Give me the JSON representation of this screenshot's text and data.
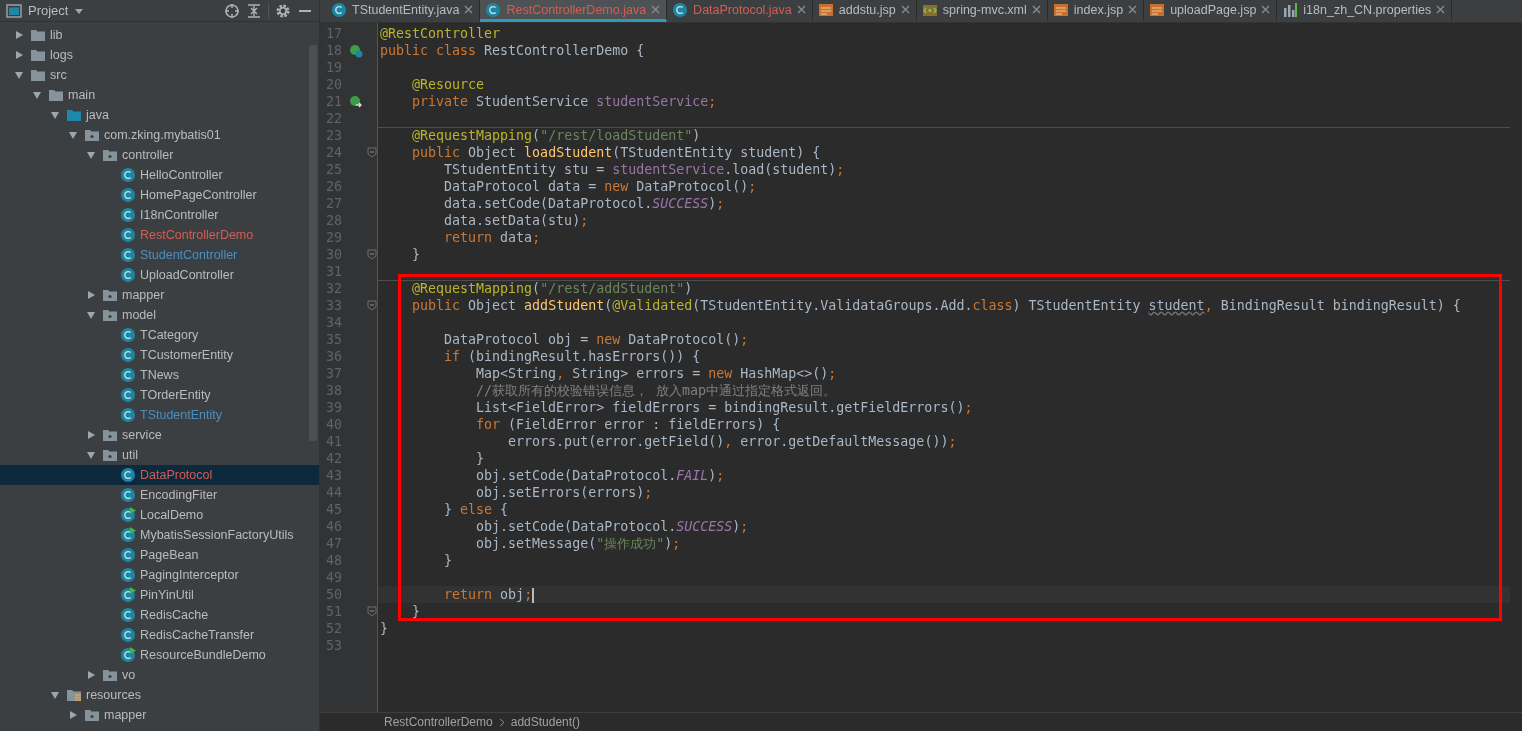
{
  "sidebar": {
    "title": "Project",
    "tree": [
      {
        "label": "lib",
        "kind": "folder",
        "expanded": false,
        "selected": false,
        "color": "#bbbbbb"
      },
      {
        "label": "logs",
        "kind": "folder",
        "expanded": false,
        "selected": false,
        "color": "#bbbbbb"
      },
      {
        "label": "src",
        "kind": "folder",
        "expanded": true,
        "selected": false,
        "color": "#bbbbbb",
        "children": [
          {
            "label": "main",
            "kind": "folder",
            "expanded": true,
            "selected": false,
            "color": "#bbbbbb",
            "children": [
              {
                "label": "java",
                "kind": "source-folder",
                "expanded": true,
                "selected": false,
                "color": "#bbbbbb",
                "children": [
                  {
                    "label": "com.zking.mybatis01",
                    "kind": "package",
                    "expanded": true,
                    "selected": false,
                    "color": "#bbbbbb",
                    "children": [
                      {
                        "label": "controller",
                        "kind": "package",
                        "expanded": true,
                        "selected": false,
                        "color": "#bbbbbb",
                        "children": [
                          {
                            "label": "HelloController",
                            "kind": "class",
                            "runnable": false,
                            "selected": false,
                            "color": "#bbbbbb"
                          },
                          {
                            "label": "HomePageController",
                            "kind": "class",
                            "runnable": false,
                            "selected": false,
                            "color": "#bbbbbb"
                          },
                          {
                            "label": "I18nController",
                            "kind": "class",
                            "runnable": false,
                            "selected": false,
                            "color": "#bbbbbb"
                          },
                          {
                            "label": "RestControllerDemo",
                            "kind": "class",
                            "runnable": false,
                            "selected": false,
                            "color": "#d65c52"
                          },
                          {
                            "label": "StudentController",
                            "kind": "class",
                            "runnable": false,
                            "selected": false,
                            "color": "#4a8fc2"
                          },
                          {
                            "label": "UploadController",
                            "kind": "class",
                            "runnable": false,
                            "selected": false,
                            "color": "#bbbbbb"
                          }
                        ]
                      },
                      {
                        "label": "mapper",
                        "kind": "package",
                        "expanded": false,
                        "selected": false,
                        "color": "#bbbbbb"
                      },
                      {
                        "label": "model",
                        "kind": "package",
                        "expanded": true,
                        "selected": false,
                        "color": "#bbbbbb",
                        "children": [
                          {
                            "label": "TCategory",
                            "kind": "class",
                            "runnable": false,
                            "selected": false,
                            "color": "#bbbbbb"
                          },
                          {
                            "label": "TCustomerEntity",
                            "kind": "class",
                            "runnable": false,
                            "selected": false,
                            "color": "#bbbbbb"
                          },
                          {
                            "label": "TNews",
                            "kind": "class",
                            "runnable": false,
                            "selected": false,
                            "color": "#bbbbbb"
                          },
                          {
                            "label": "TOrderEntity",
                            "kind": "class",
                            "runnable": false,
                            "selected": false,
                            "color": "#bbbbbb"
                          },
                          {
                            "label": "TStudentEntity",
                            "kind": "class",
                            "runnable": false,
                            "selected": false,
                            "color": "#4a8fc2"
                          }
                        ]
                      },
                      {
                        "label": "service",
                        "kind": "package",
                        "expanded": false,
                        "selected": false,
                        "color": "#bbbbbb"
                      },
                      {
                        "label": "util",
                        "kind": "package",
                        "expanded": true,
                        "selected": false,
                        "color": "#bbbbbb",
                        "children": [
                          {
                            "label": "DataProtocol",
                            "kind": "class",
                            "runnable": false,
                            "selected": true,
                            "color": "#d65c52"
                          },
                          {
                            "label": "EncodingFiter",
                            "kind": "class",
                            "runnable": false,
                            "selected": false,
                            "color": "#bbbbbb"
                          },
                          {
                            "label": "LocalDemo",
                            "kind": "class",
                            "runnable": true,
                            "selected": false,
                            "color": "#bbbbbb"
                          },
                          {
                            "label": "MybatisSessionFactoryUtils",
                            "kind": "class",
                            "runnable": true,
                            "selected": false,
                            "color": "#bbbbbb"
                          },
                          {
                            "label": "PageBean",
                            "kind": "class",
                            "runnable": false,
                            "selected": false,
                            "color": "#bbbbbb"
                          },
                          {
                            "label": "PagingInterceptor",
                            "kind": "class",
                            "runnable": false,
                            "selected": false,
                            "color": "#bbbbbb"
                          },
                          {
                            "label": "PinYinUtil",
                            "kind": "class",
                            "runnable": true,
                            "selected": false,
                            "color": "#bbbbbb"
                          },
                          {
                            "label": "RedisCache",
                            "kind": "class",
                            "runnable": false,
                            "selected": false,
                            "color": "#bbbbbb"
                          },
                          {
                            "label": "RedisCacheTransfer",
                            "kind": "class",
                            "runnable": false,
                            "selected": false,
                            "color": "#bbbbbb"
                          },
                          {
                            "label": "ResourceBundleDemo",
                            "kind": "class",
                            "runnable": true,
                            "selected": false,
                            "color": "#bbbbbb"
                          }
                        ]
                      },
                      {
                        "label": "vo",
                        "kind": "package",
                        "expanded": false,
                        "selected": false,
                        "color": "#bbbbbb"
                      }
                    ]
                  }
                ]
              },
              {
                "label": "resources",
                "kind": "resource-folder",
                "expanded": true,
                "selected": false,
                "color": "#bbbbbb",
                "children": [
                  {
                    "label": "mapper",
                    "kind": "package",
                    "expanded": false,
                    "selected": false,
                    "color": "#bbbbbb"
                  }
                ]
              }
            ]
          }
        ]
      }
    ]
  },
  "tabs": [
    {
      "label": "TStudentEntity.java",
      "kind": "class",
      "color": "#bbbbbb",
      "selected": false
    },
    {
      "label": "RestControllerDemo.java",
      "kind": "class",
      "color": "#d65c52",
      "selected": true
    },
    {
      "label": "DataProtocol.java",
      "kind": "class",
      "color": "#d65c52",
      "selected": false
    },
    {
      "label": "addstu.jsp",
      "kind": "jsp",
      "color": "#bbbbbb",
      "selected": false
    },
    {
      "label": "spring-mvc.xml",
      "kind": "xml",
      "color": "#bbbbbb",
      "selected": false
    },
    {
      "label": "index.jsp",
      "kind": "jsp",
      "color": "#bbbbbb",
      "selected": false
    },
    {
      "label": "uploadPage.jsp",
      "kind": "jsp",
      "color": "#bbbbbb",
      "selected": false
    },
    {
      "label": "i18n_zh_CN.properties",
      "kind": "properties",
      "color": "#bbbbbb",
      "selected": false
    }
  ],
  "editor": {
    "sections": [
      {
        "boxed": false,
        "lines": [
          {
            "number": "17",
            "tokens": [
              {
                "kind": "annotation",
                "text": "@RestController"
              }
            ]
          },
          {
            "number": "18",
            "bean_marker": true,
            "tokens": [
              {
                "kind": "keyword",
                "text": "public class "
              },
              {
                "kind": "plain",
                "text": "RestControllerDemo {"
              }
            ]
          },
          {
            "number": "19"
          },
          {
            "number": "20",
            "tokens": [
              {
                "kind": "annotation",
                "text": "    @Resource"
              }
            ]
          },
          {
            "number": "21",
            "injection_marker": true,
            "tokens": [
              {
                "kind": "keyword",
                "text": "    private "
              },
              {
                "kind": "plain",
                "text": "StudentService "
              },
              {
                "kind": "field",
                "text": "studentService"
              },
              {
                "kind": "keyword",
                "text": ";"
              }
            ]
          },
          {
            "number": "22"
          },
          {
            "number": "23",
            "separator": true,
            "tokens": [
              {
                "kind": "annotation",
                "text": "    @RequestMapping"
              },
              {
                "kind": "plain",
                "text": "("
              },
              {
                "kind": "string",
                "text": "\"/rest/loadStudent\""
              },
              {
                "kind": "plain",
                "text": ")"
              }
            ]
          },
          {
            "number": "24",
            "fold_marker": true,
            "tokens": [
              {
                "kind": "keyword",
                "text": "    public "
              },
              {
                "kind": "plain",
                "text": "Object "
              },
              {
                "kind": "method",
                "text": "loadStudent"
              },
              {
                "kind": "plain",
                "text": "(TStudentEntity student) {"
              }
            ]
          },
          {
            "number": "25",
            "tokens": [
              {
                "kind": "plain",
                "text": "        TStudentEntity stu = "
              },
              {
                "kind": "field",
                "text": "studentService"
              },
              {
                "kind": "plain",
                "text": ".load(student)"
              },
              {
                "kind": "keyword",
                "text": ";"
              }
            ]
          },
          {
            "number": "26",
            "tokens": [
              {
                "kind": "plain",
                "text": "        DataProtocol data = "
              },
              {
                "kind": "keyword",
                "text": "new "
              },
              {
                "kind": "plain",
                "text": "DataProtocol()"
              },
              {
                "kind": "keyword",
                "text": ";"
              }
            ]
          },
          {
            "number": "27",
            "tokens": [
              {
                "kind": "plain",
                "text": "        data.setCode(DataProtocol."
              },
              {
                "kind": "static",
                "text": "SUCCESS"
              },
              {
                "kind": "plain",
                "text": ")"
              },
              {
                "kind": "keyword",
                "text": ";"
              }
            ]
          },
          {
            "number": "28",
            "tokens": [
              {
                "kind": "plain",
                "text": "        data.setData(stu)"
              },
              {
                "kind": "keyword",
                "text": ";"
              }
            ]
          },
          {
            "number": "29",
            "tokens": [
              {
                "kind": "keyword",
                "text": "        return "
              },
              {
                "kind": "plain",
                "text": "data"
              },
              {
                "kind": "keyword",
                "text": ";"
              }
            ]
          },
          {
            "number": "30",
            "fold_marker": true,
            "tokens": [
              {
                "kind": "plain",
                "text": "    }"
              }
            ]
          },
          {
            "number": "31"
          }
        ]
      },
      {
        "boxed": true,
        "lines": [
          {
            "number": "32",
            "separator": true,
            "tokens": [
              {
                "kind": "annotation",
                "text": "    @RequestMapping"
              },
              {
                "kind": "plain",
                "text": "("
              },
              {
                "kind": "string",
                "text": "\"/rest/addStudent\""
              },
              {
                "kind": "plain",
                "text": ")"
              }
            ]
          },
          {
            "number": "33",
            "fold_marker": true,
            "tokens": [
              {
                "kind": "keyword",
                "text": "    public "
              },
              {
                "kind": "plain",
                "text": "Object "
              },
              {
                "kind": "method",
                "text": "addStudent"
              },
              {
                "kind": "plain",
                "text": "("
              },
              {
                "kind": "annotation",
                "text": "@Validated"
              },
              {
                "kind": "plain",
                "text": "(TStudentEntity.ValidataGroups.Add."
              },
              {
                "kind": "keyword",
                "text": "class"
              },
              {
                "kind": "plain",
                "text": ") TStudentEntity "
              },
              {
                "kind": "warning",
                "text": "student"
              },
              {
                "kind": "keyword",
                "text": ","
              },
              {
                "kind": "plain",
                "text": " BindingResult bindingResult) {"
              }
            ]
          },
          {
            "number": "34"
          },
          {
            "number": "35",
            "tokens": [
              {
                "kind": "plain",
                "text": "        DataProtocol obj = "
              },
              {
                "kind": "keyword",
                "text": "new "
              },
              {
                "kind": "plain",
                "text": "DataProtocol()"
              },
              {
                "kind": "keyword",
                "text": ";"
              }
            ]
          },
          {
            "number": "36",
            "tokens": [
              {
                "kind": "keyword",
                "text": "        if "
              },
              {
                "kind": "plain",
                "text": "(bindingResult.hasErrors()) {"
              }
            ]
          },
          {
            "number": "37",
            "tokens": [
              {
                "kind": "plain",
                "text": "            Map<String"
              },
              {
                "kind": "keyword",
                "text": ","
              },
              {
                "kind": "plain",
                "text": " String> errors = "
              },
              {
                "kind": "keyword",
                "text": "new "
              },
              {
                "kind": "plain",
                "text": "HashMap<>()"
              },
              {
                "kind": "keyword",
                "text": ";"
              }
            ]
          },
          {
            "number": "38",
            "tokens": [
              {
                "kind": "comment",
                "text": "            //获取所有的校验错误信息， 放入map中通过指定格式返回。"
              }
            ]
          },
          {
            "number": "39",
            "tokens": [
              {
                "kind": "plain",
                "text": "            List<FieldError> fieldErrors = bindingResult.getFieldErrors()"
              },
              {
                "kind": "keyword",
                "text": ";"
              }
            ]
          },
          {
            "number": "40",
            "tokens": [
              {
                "kind": "keyword",
                "text": "            for "
              },
              {
                "kind": "plain",
                "text": "(FieldError error : fieldErrors) {"
              }
            ]
          },
          {
            "number": "41",
            "tokens": [
              {
                "kind": "plain",
                "text": "                errors.put(error.getField()"
              },
              {
                "kind": "keyword",
                "text": ","
              },
              {
                "kind": "plain",
                "text": " error.getDefaultMessage())"
              },
              {
                "kind": "keyword",
                "text": ";"
              }
            ]
          },
          {
            "number": "42",
            "tokens": [
              {
                "kind": "plain",
                "text": "            }"
              }
            ]
          },
          {
            "number": "43",
            "tokens": [
              {
                "kind": "plain",
                "text": "            obj.setCode(DataProtocol."
              },
              {
                "kind": "static",
                "text": "FAIL"
              },
              {
                "kind": "plain",
                "text": ")"
              },
              {
                "kind": "keyword",
                "text": ";"
              }
            ]
          },
          {
            "number": "44",
            "tokens": [
              {
                "kind": "plain",
                "text": "            obj.setErrors(errors)"
              },
              {
                "kind": "keyword",
                "text": ";"
              }
            ]
          },
          {
            "number": "45",
            "tokens": [
              {
                "kind": "plain",
                "text": "        } "
              },
              {
                "kind": "keyword",
                "text": "else "
              },
              {
                "kind": "plain",
                "text": "{"
              }
            ]
          },
          {
            "number": "46",
            "tokens": [
              {
                "kind": "plain",
                "text": "            obj.setCode(DataProtocol."
              },
              {
                "kind": "static",
                "text": "SUCCESS"
              },
              {
                "kind": "plain",
                "text": ")"
              },
              {
                "kind": "keyword",
                "text": ";"
              }
            ]
          },
          {
            "number": "47",
            "tokens": [
              {
                "kind": "plain",
                "text": "            obj.setMessage("
              },
              {
                "kind": "string",
                "text": "\"操作成功\""
              },
              {
                "kind": "plain",
                "text": ")"
              },
              {
                "kind": "keyword",
                "text": ";"
              }
            ]
          },
          {
            "number": "48",
            "tokens": [
              {
                "kind": "plain",
                "text": "        }"
              }
            ]
          },
          {
            "number": "49"
          },
          {
            "number": "50",
            "current": true,
            "tokens": [
              {
                "kind": "keyword",
                "text": "        return "
              },
              {
                "kind": "plain",
                "text": "obj"
              },
              {
                "kind": "keyword",
                "text": ";"
              }
            ]
          },
          {
            "number": "51",
            "fold_marker": true,
            "tokens": [
              {
                "kind": "plain",
                "text": "    }"
              }
            ]
          }
        ]
      },
      {
        "boxed": false,
        "lines": [
          {
            "number": "52",
            "tokens": [
              {
                "kind": "plain",
                "text": "}"
              }
            ]
          },
          {
            "number": "53"
          }
        ]
      }
    ],
    "breadcrumb": [
      "RestControllerDemo",
      "addStudent()"
    ]
  }
}
